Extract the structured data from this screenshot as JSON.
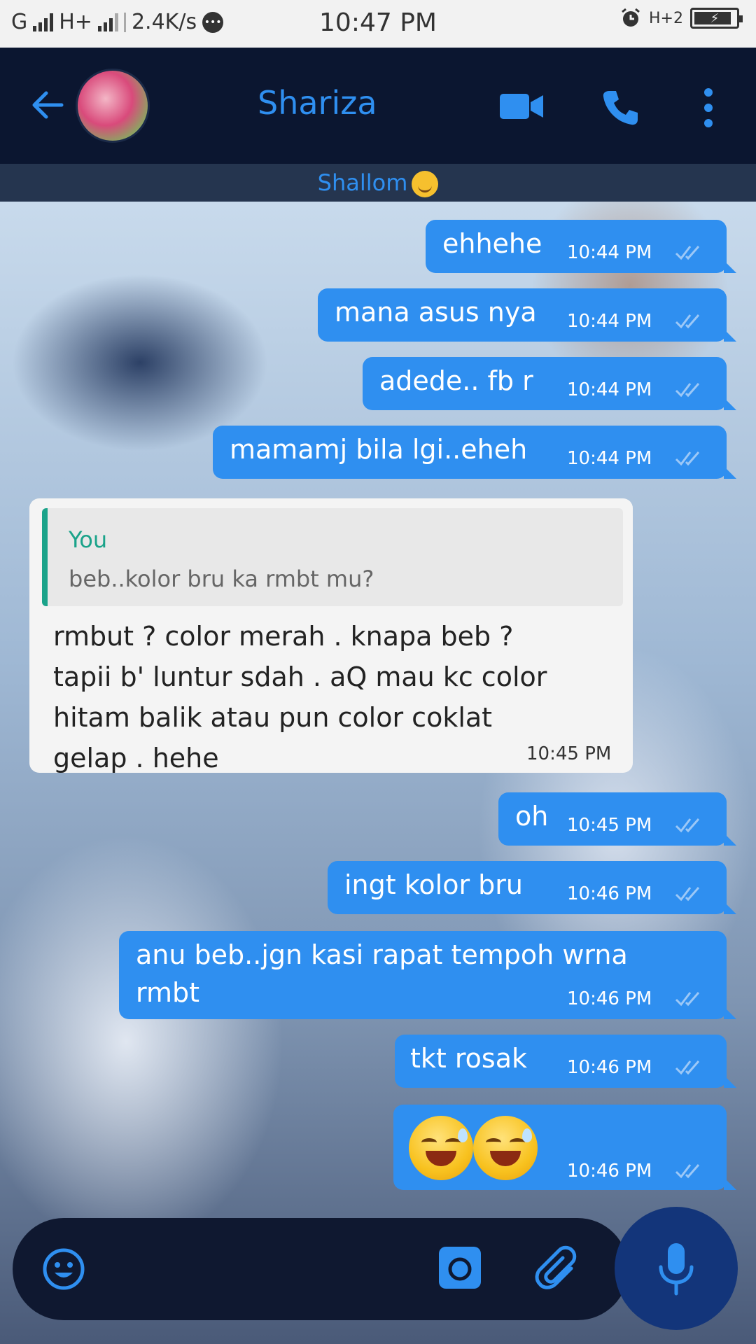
{
  "status_bar": {
    "network_1": "G",
    "network_2": "H+",
    "speed": "2.4K/s",
    "time": "10:47 PM",
    "network_3": "H+2"
  },
  "header": {
    "contact_name": "Shariza",
    "status_text": "Shallom",
    "accent_color": "#2f8ff0",
    "background_color": "#0b1630"
  },
  "messages": [
    {
      "direction": "out",
      "text": "ehhehe",
      "time": "10:44 PM"
    },
    {
      "direction": "out",
      "text": "mana asus nya",
      "time": "10:44 PM"
    },
    {
      "direction": "out",
      "text": "adede.. fb r",
      "time": "10:44 PM"
    },
    {
      "direction": "out",
      "text": "mamamj bila lgi..eheh",
      "time": "10:44 PM"
    },
    {
      "direction": "in",
      "quote_author": "You",
      "quote_text": "beb..kolor bru ka rmbt mu?",
      "lines": [
        "rmbut ? color merah . knapa beb ?",
        "tapii b' luntur sdah . aQ mau kc color",
        "hitam balik atau pun color coklat",
        "gelap . hehe"
      ],
      "time": "10:45 PM"
    },
    {
      "direction": "out",
      "text": "oh",
      "time": "10:45 PM"
    },
    {
      "direction": "out",
      "text": "ingt kolor bru",
      "time": "10:46 PM"
    },
    {
      "direction": "out",
      "lines": [
        "anu beb..jgn kasi rapat tempoh wrna",
        "rmbt"
      ],
      "time": "10:46 PM"
    },
    {
      "direction": "out",
      "text": "tkt rosak",
      "time": "10:46 PM"
    },
    {
      "direction": "out",
      "emoji": [
        "smiling-face-with-sweat",
        "smiling-face-with-sweat"
      ],
      "time": "10:46 PM"
    }
  ],
  "input_bar": {
    "icons": [
      "emoji-icon",
      "camera-icon",
      "paperclip-icon",
      "microphone-icon"
    ]
  }
}
